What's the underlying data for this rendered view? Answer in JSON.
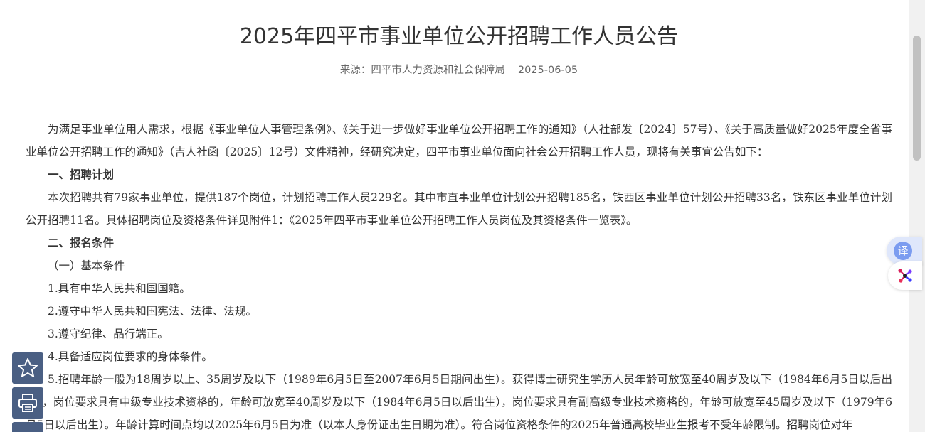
{
  "article": {
    "title": "2025年四平市事业单位公开招聘工作人员公告",
    "source": "来源：四平市人力资源和社会保障局",
    "date": "2025-06-05",
    "paragraphs": {
      "intro": "为满足事业单位用人需求，根据《事业单位人事管理条例》、《关于进一步做好事业单位公开招聘工作的通知》（人社部发〔2024〕57号）、《关于高质量做好2025年度全省事业单位公开招聘工作的通知》（吉人社函〔2025〕12号）文件精神，经研究决定，四平市事业单位面向社会公开招聘工作人员，现将有关事宜公告如下：",
      "h1": "一、招聘计划",
      "plan": "本次招聘共有79家事业单位，提供187个岗位，计划招聘工作人员229名。其中市直事业单位计划公开招聘185名，铁西区事业单位计划公开招聘33名，铁东区事业单位计划公开招聘11名。具体招聘岗位及资格条件详见附件1：《2025年四平市事业单位公开招聘工作人员岗位及其资格条件一览表》。",
      "h2": "二、报名条件",
      "sub1": "（一）基本条件",
      "c1": "1.具有中华人民共和国国籍。",
      "c2": "2.遵守中华人民共和国宪法、法律、法规。",
      "c3": "3.遵守纪律、品行端正。",
      "c4": "4.具备适应岗位要求的身体条件。",
      "c5": "5.招聘年龄一般为18周岁以上、35周岁及以下（1989年6月5日至2007年6月5日期间出生）。获得博士研究生学历人员年龄可放宽至40周岁及以下（1984年6月5日以后出生），岗位要求具有中级专业技术资格的，年龄可放宽至40周岁及以下（1984年6月5日以后出生），岗位要求具有副高级专业技术资格的，年龄可放宽至45周岁及以下（1979年6月5日以后出生）。年龄计算时间点均以2025年6月5日为准（以本人身份证出生日期为准）。符合岗位资格条件的2025年普通高校毕业生报考不受年龄限制。招聘岗位对年"
    }
  },
  "floating_tools": {
    "favorite_icon": "star-icon",
    "print_icon": "printer-icon",
    "translate_label": "译",
    "ai_icon": "ai-assistant-icon"
  },
  "colors": {
    "tool_button": "#4a5f83",
    "translate_bg": "#dfe7fb",
    "translate_accent": "#7b9cf0"
  }
}
